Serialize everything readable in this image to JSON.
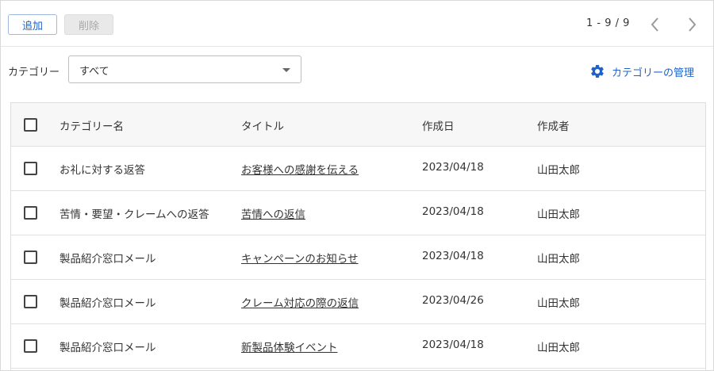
{
  "toolbar": {
    "add_label": "追加",
    "delete_label": "削除",
    "pager_text": "1 - 9 / 9"
  },
  "filter": {
    "label": "カテゴリー",
    "selected": "すべて",
    "manage_label": "カテゴリーの管理"
  },
  "table": {
    "headers": {
      "category": "カテゴリー名",
      "title": "タイトル",
      "created": "作成日",
      "author": "作成者"
    },
    "rows": [
      {
        "category": "お礼に対する返答",
        "title": "お客様への感謝を伝える",
        "created": "2023/04/18",
        "author": "山田太郎"
      },
      {
        "category": "苦情・要望・クレームへの返答",
        "title": "苦情への返信",
        "created": "2023/04/18",
        "author": "山田太郎"
      },
      {
        "category": "製品紹介窓口メール",
        "title": "キャンペーンのお知らせ",
        "created": "2023/04/18",
        "author": "山田太郎"
      },
      {
        "category": "製品紹介窓口メール",
        "title": "クレーム対応の際の返信",
        "created": "2023/04/26",
        "author": "山田太郎"
      },
      {
        "category": "製品紹介窓口メール",
        "title": "新製品体験イベント",
        "created": "2023/04/18",
        "author": "山田太郎"
      }
    ]
  },
  "colors": {
    "accent": "#1f63c9",
    "header_bg": "#f7f7f7",
    "border": "#dddddd"
  },
  "icons": {
    "prev": "chevron-left-icon",
    "next": "chevron-right-icon",
    "manage": "gear-icon",
    "select": "caret-down-icon"
  }
}
